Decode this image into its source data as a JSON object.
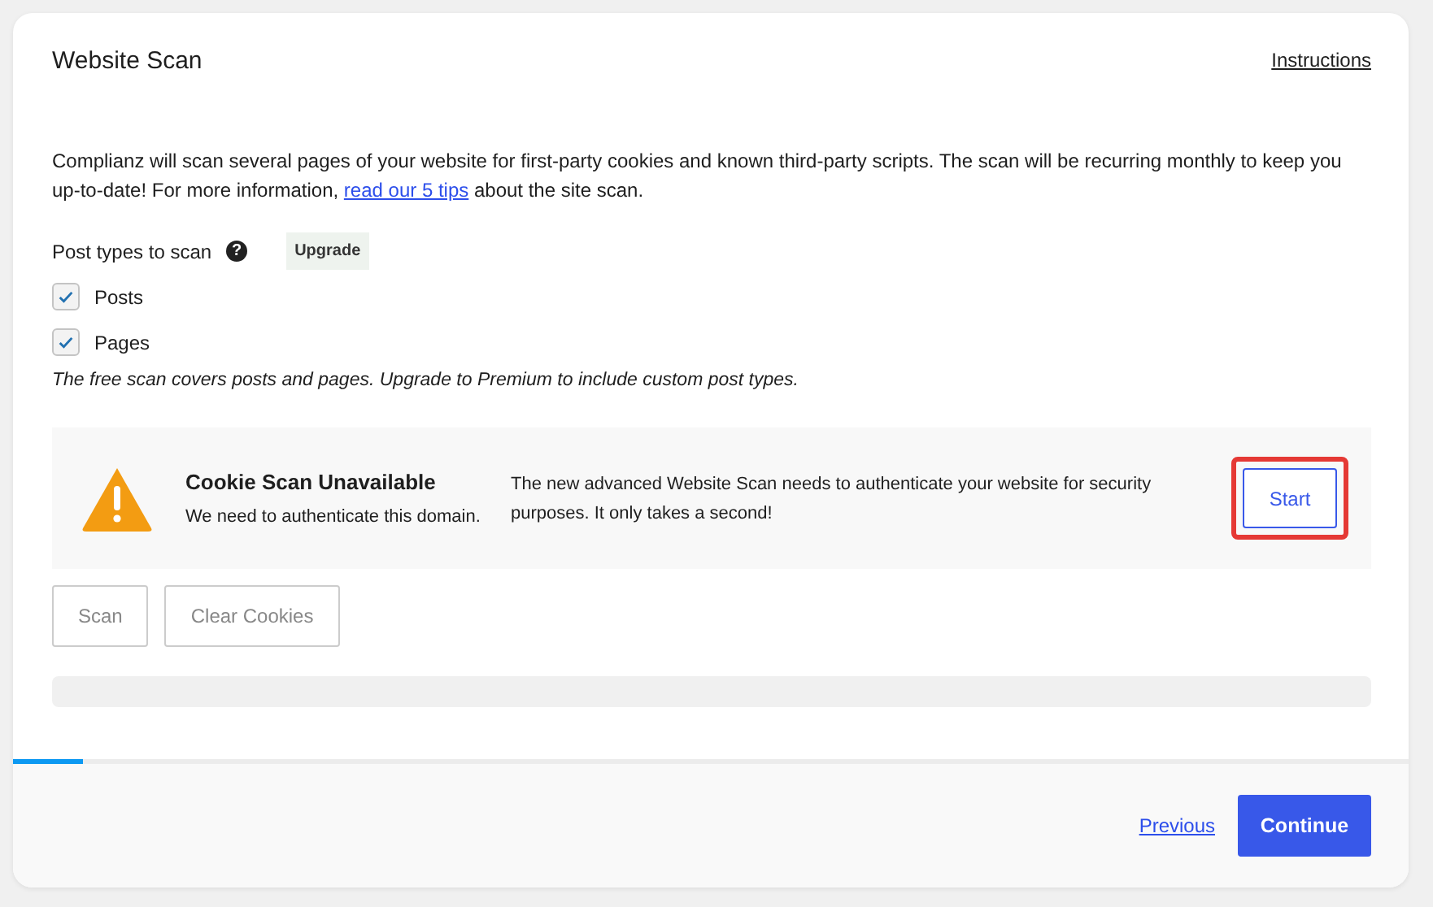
{
  "header": {
    "title": "Website Scan",
    "instructions_link": "Instructions"
  },
  "intro": {
    "text": "Complianz will scan several pages of your website for first-party cookies and known third-party scripts. The scan will be recurring monthly to keep you up-to-date! For more information, ",
    "link": "read our 5 tips",
    "after": " about the site scan."
  },
  "post_types": {
    "label": "Post types to scan",
    "help_icon": "?",
    "badge": "Upgrade",
    "options": [
      {
        "label": "Posts",
        "checked": true
      },
      {
        "label": "Pages",
        "checked": true
      }
    ],
    "note": "The free scan covers posts and pages. Upgrade to Premium to include custom post types."
  },
  "notice": {
    "title": "Cookie Scan Unavailable",
    "subtitle": "We need to authenticate this domain.",
    "message": "The new advanced Website Scan needs to authenticate your website for security purposes. It only takes a second!",
    "button": "Start",
    "highlighted": true
  },
  "actions": [
    {
      "label": "Scan",
      "disabled": true
    },
    {
      "label": "Clear Cookies",
      "disabled": true
    }
  ],
  "step_progress": {
    "level": 0.05
  },
  "footer": {
    "previous": "Previous",
    "continue": "Continue"
  }
}
